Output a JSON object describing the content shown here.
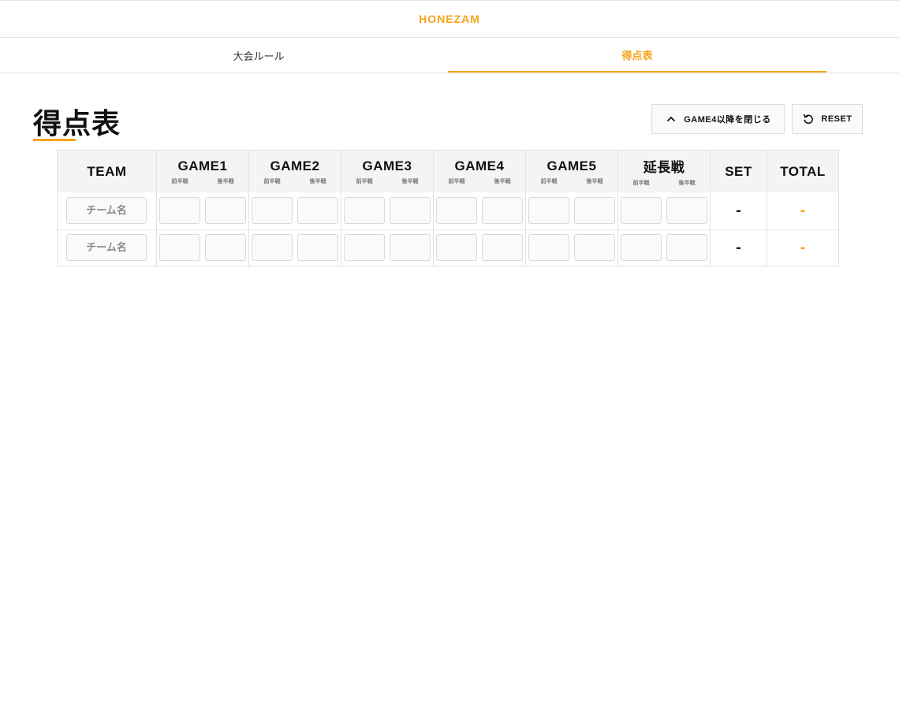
{
  "brand": "HONEZAM",
  "tabs": [
    {
      "label": "大会ルール",
      "active": false
    },
    {
      "label": "得点表",
      "active": true
    }
  ],
  "page_title": "得点表",
  "buttons": {
    "collapse": "GAME4以降を閉じる",
    "reset": "RESET"
  },
  "icons": {
    "collapse": "chevron-up-icon",
    "reset": "reset-icon"
  },
  "table": {
    "team_header": "TEAM",
    "games": [
      {
        "label": "GAME1",
        "first": "前半戦",
        "second": "後半戦"
      },
      {
        "label": "GAME2",
        "first": "前半戦",
        "second": "後半戦"
      },
      {
        "label": "GAME3",
        "first": "前半戦",
        "second": "後半戦"
      },
      {
        "label": "GAME4",
        "first": "前半戦",
        "second": "後半戦"
      },
      {
        "label": "GAME5",
        "first": "前半戦",
        "second": "後半戦"
      },
      {
        "label": "延長戦",
        "first": "前半戦",
        "second": "後半戦"
      }
    ],
    "set_header": "SET",
    "total_header": "TOTAL",
    "rows": [
      {
        "team_placeholder": "チーム名",
        "set": "-",
        "total": "-"
      },
      {
        "team_placeholder": "チーム名",
        "set": "-",
        "total": "-"
      }
    ]
  },
  "colors": {
    "accent": "#f5a31a",
    "header_bg": "#f4f4f4"
  }
}
